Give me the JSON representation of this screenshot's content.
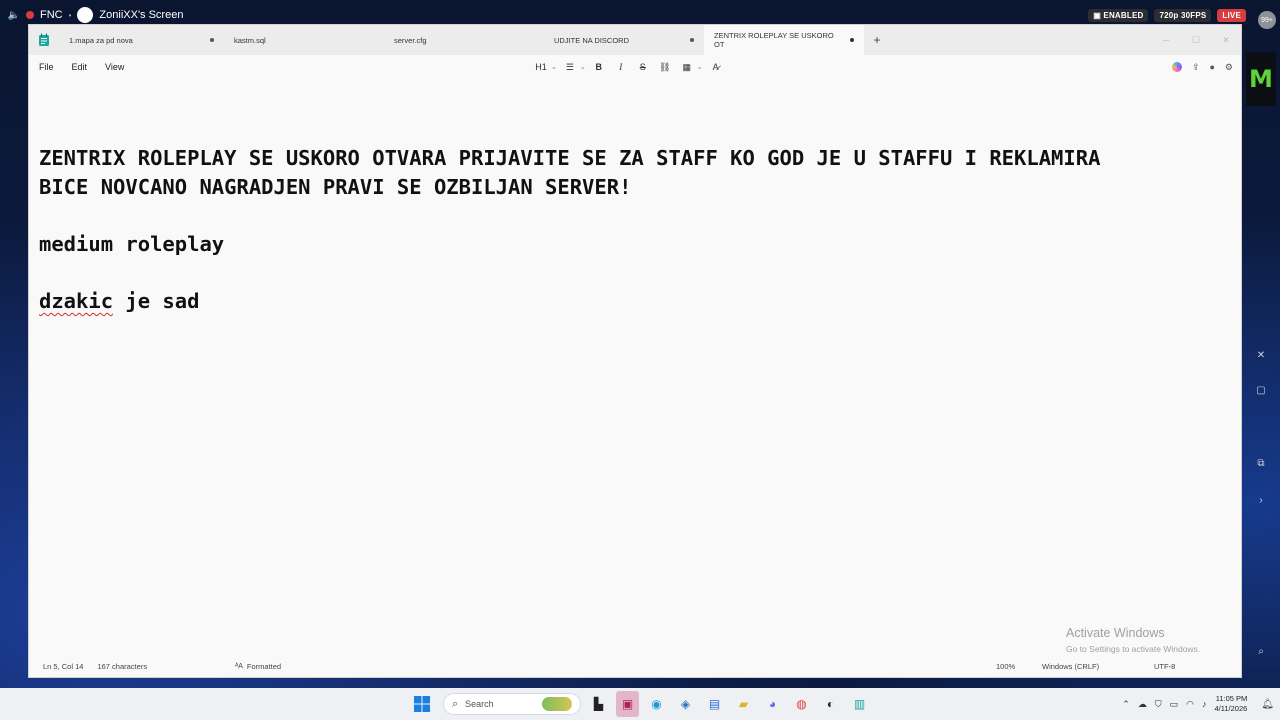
{
  "stream": {
    "channel": "FNC",
    "screen_title": "ZoniiXX's Screen",
    "enabled_label": "ENABLED",
    "quality_label": "720p 30FPS",
    "live_label": "LIVE",
    "viewer_count": "99+"
  },
  "notepad": {
    "tabs": [
      {
        "label": "1.mapa za pd nova",
        "modified": true
      },
      {
        "label": "kastm.sql",
        "modified": false
      },
      {
        "label": "server.cfg",
        "modified": false
      },
      {
        "label": "UDJITE NA DISCORD",
        "modified": true
      },
      {
        "label": "ZENTRIX ROLEPLAY SE USKORO OT",
        "modified": true,
        "active": true
      }
    ],
    "add_tab": "+",
    "menu": {
      "file": "File",
      "edit": "Edit",
      "view": "View"
    },
    "format": {
      "heading": "H1",
      "bold": "B",
      "italic": "I",
      "strike": "S"
    },
    "content": {
      "line1": "ZENTRIX ROLEPLAY SE USKORO OTVARA PRIJAVITE SE ZA STAFF KO GOD JE U STAFFU I REKLAMIRA",
      "line2": "BICE NOVCANO NAGRADJEN PRAVI SE OZBILJAN SERVER!",
      "line3": "medium roleplay",
      "line4_word1": "dzakic",
      "line4_rest": " je sad"
    },
    "status": {
      "position": "Ln 5, Col 14",
      "characters": "167 characters",
      "formatted": "Formatted",
      "zoom": "100%",
      "line_endings": "Windows (CRLF)",
      "encoding": "UTF-8"
    }
  },
  "watermark": {
    "title": "Activate Windows",
    "subtitle": "Go to Settings to activate Windows."
  },
  "taskbar": {
    "search_placeholder": "Search",
    "time": "11:05 PM",
    "date": "4/11/2026"
  }
}
